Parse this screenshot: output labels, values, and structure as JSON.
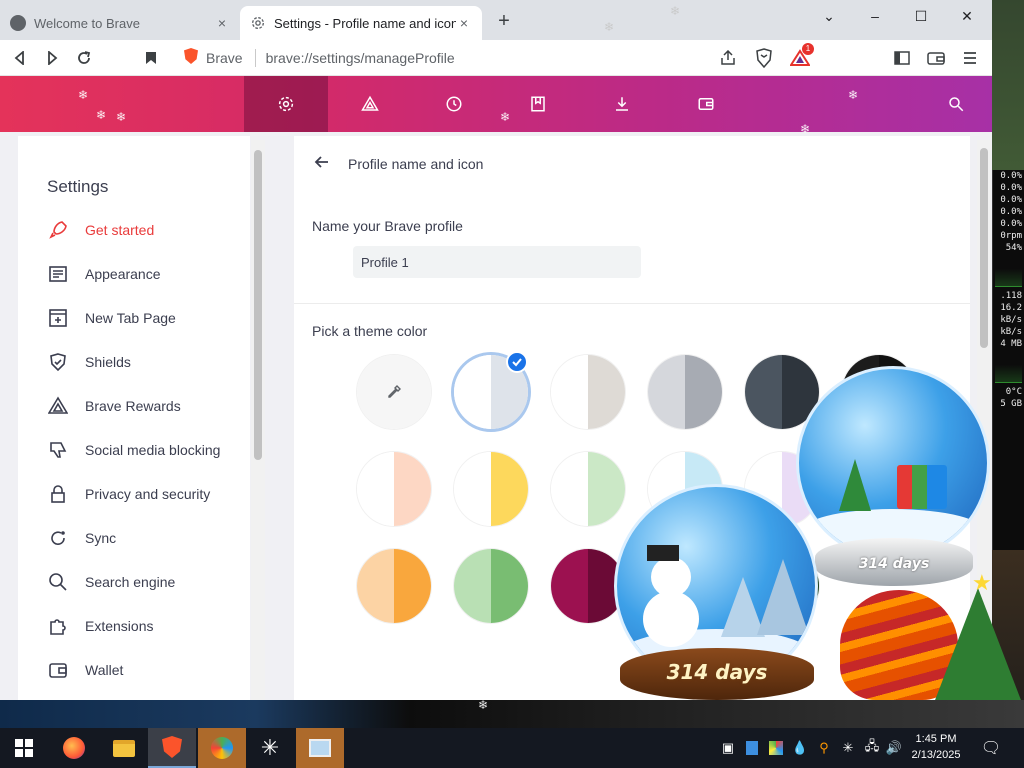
{
  "window": {
    "tabs": [
      {
        "label": "Welcome to Brave",
        "close": "×"
      },
      {
        "label": "Settings - Profile name and icon",
        "close": "×"
      }
    ],
    "new_tab": "+",
    "controls": {
      "tab_list": "⌄",
      "minimize": "–",
      "maximize": "☐",
      "close": "✕"
    }
  },
  "toolbar": {
    "brand": "Brave",
    "url": "brave://settings/manageProfile",
    "rewards_badge": "1"
  },
  "header_nav": {
    "items": [
      "settings-icon",
      "rewards-icon",
      "history-icon",
      "bookmarks-icon",
      "downloads-icon",
      "wallet-icon",
      "search-icon"
    ],
    "selected": "settings-icon"
  },
  "sidebar": {
    "title": "Settings",
    "items": [
      {
        "label": "Get started",
        "icon": "rocket-icon",
        "active": true
      },
      {
        "label": "Appearance",
        "icon": "appearance-icon"
      },
      {
        "label": "New Tab Page",
        "icon": "new-tab-page-icon"
      },
      {
        "label": "Shields",
        "icon": "shield-icon"
      },
      {
        "label": "Brave Rewards",
        "icon": "rewards-icon"
      },
      {
        "label": "Social media blocking",
        "icon": "thumbs-down-icon"
      },
      {
        "label": "Privacy and security",
        "icon": "lock-icon"
      },
      {
        "label": "Sync",
        "icon": "sync-icon"
      },
      {
        "label": "Search engine",
        "icon": "search-icon"
      },
      {
        "label": "Extensions",
        "icon": "puzzle-icon"
      },
      {
        "label": "Wallet",
        "icon": "wallet-icon"
      }
    ]
  },
  "content": {
    "title": "Profile name and icon",
    "name_section": "Name your Brave profile",
    "profile_name": "Profile 1",
    "theme_section": "Pick a theme color",
    "selected_theme_index": 1,
    "themes": [
      {
        "left": "#f6f6f6",
        "right": "#f6f6f6",
        "picker": true
      },
      {
        "left": "#ffffff",
        "right": "#dee3ea"
      },
      {
        "left": "#ffffff",
        "right": "#dedad5"
      },
      {
        "left": "#d5d7dc",
        "right": "#a7abb3"
      },
      {
        "left": "#4b5560",
        "right": "#2e353d"
      },
      {
        "left": "#1c1c1c",
        "right": "#111111"
      },
      {
        "left": "#ffffff",
        "right": "#fdd7c4"
      },
      {
        "left": "#ffffff",
        "right": "#fdd85c"
      },
      {
        "left": "#ffffff",
        "right": "#cbe8c6"
      },
      {
        "left": "#ffffff",
        "right": "#c7e9f6"
      },
      {
        "left": "#ffffff",
        "right": "#eadcf6"
      },
      {
        "left": "#f5d3ca",
        "right": "#e0a596"
      },
      {
        "left": "#fcd3a4",
        "right": "#f9a73d"
      },
      {
        "left": "#b9e0b4",
        "right": "#79bd72"
      },
      {
        "left": "#9c1150",
        "right": "#6b0a36"
      },
      {
        "left": "#a31c1c",
        "right": "#741010"
      },
      {
        "left": "#265e2a",
        "right": "#163c19"
      }
    ]
  },
  "widgets": {
    "globe_small_label": "314 days",
    "globe_large_label": "314 days"
  },
  "system_gadget": {
    "lines": [
      "0.0%",
      "0.0%",
      "0.0%",
      "0.0%",
      "0.0%",
      "0rpm",
      "54%",
      "",
      ".118",
      "16.2",
      "kB/s",
      "kB/s",
      "4 MB",
      "",
      "0°C",
      "5 GB"
    ]
  },
  "taskbar": {
    "apps": [
      "windows-start-icon",
      "firefox-icon",
      "file-explorer-icon",
      "brave-icon",
      "desktop-gadget-icon",
      "snowflake-icon",
      "slideshow-icon"
    ],
    "active_app": "brave-icon",
    "time": "1:45 PM",
    "date": "2/13/2025"
  }
}
